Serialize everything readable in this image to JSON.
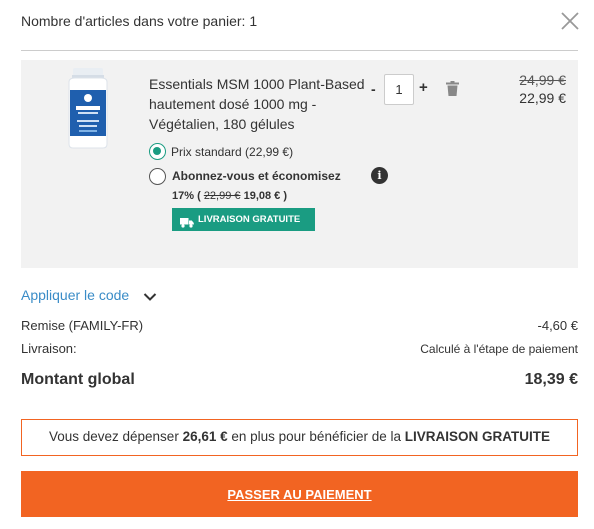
{
  "header": {
    "title": "Nombre d'articles dans votre panier: 1",
    "close_icon": "close-icon"
  },
  "item": {
    "name": "Essentials MSM 1000 Plant-Based hautement dosé 1000 mg - Végétalien, 180 gélules",
    "image_icon": "supplement-bottle",
    "quantity": "1",
    "quantity_minus": "-",
    "quantity_plus": "+",
    "price_old": "24,99 €",
    "price_new": "22,99 €",
    "option_standard": "Prix standard (22,99 €)",
    "option_subscribe": "Abonnez-vous et économisez",
    "subscribe_percent": "17% (",
    "subscribe_old": "22,99 €",
    "subscribe_new": "19,08 € )",
    "badge": "LIVRAISON GRATUITE",
    "info_glyph": "i"
  },
  "coupon": {
    "label": "Appliquer le code"
  },
  "summary": {
    "discount_label": "Remise (FAMILY-FR)",
    "discount_value": "-4,60 €",
    "shipping_label": "Livraison:",
    "shipping_value": "Calculé à l'étape de paiement",
    "total_label": "Montant global",
    "total_value": "18,39 €"
  },
  "notice": {
    "prefix": "Vous devez dépenser ",
    "amount": "26,61 €",
    "middle": " en plus pour bénéficier de la ",
    "emphasis": "LIVRAISON GRATUITE"
  },
  "checkout": {
    "label": "PASSER AU PAIEMENT"
  },
  "colors": {
    "accent_orange": "#f26422",
    "accent_green": "#1a9c82",
    "link_blue": "#3a8cc7",
    "panel_bg": "#f2f2f2"
  }
}
